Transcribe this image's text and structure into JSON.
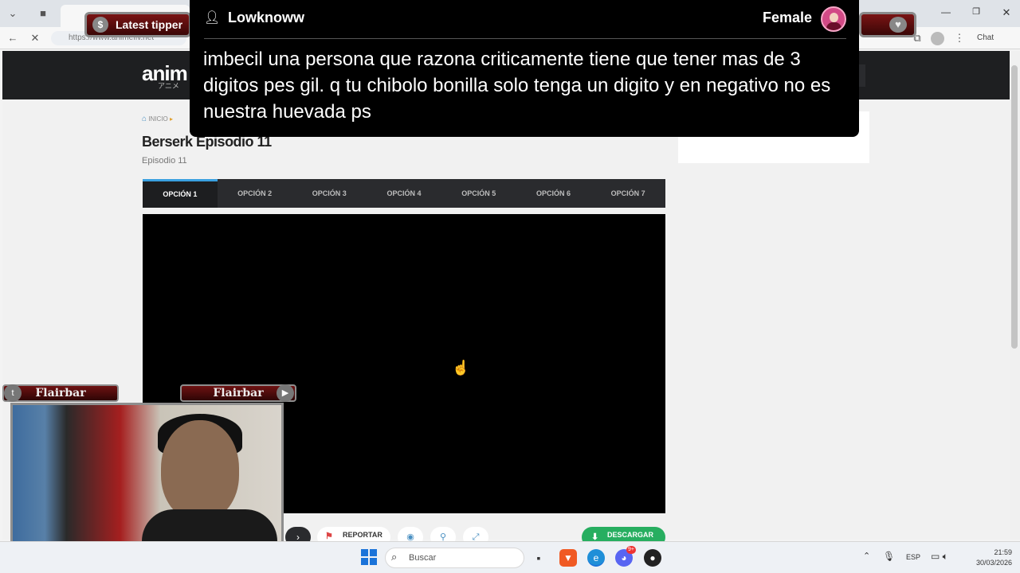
{
  "browser": {
    "url": "https://www.animeflv.net",
    "chat_label": "Chat",
    "min_icon": "minimize-icon",
    "max_icon": "maximize-icon",
    "close_icon": "close-icon"
  },
  "site": {
    "logo": "anim",
    "logo_sub": "アニメ",
    "breadcrumb_home": "INICIO",
    "title": "Berserk Episodio 11",
    "subtitle": "Episodio 11",
    "tabs": [
      "OPCIÓN 1",
      "OPCIÓN 2",
      "OPCIÓN 3",
      "OPCIÓN 4",
      "OPCIÓN 5",
      "OPCIÓN 6",
      "OPCIÓN 7"
    ],
    "active_tab": 0,
    "report_label": "REPORTAR",
    "download_label": "DESCARGAR"
  },
  "chat": {
    "username": "Lowknoww",
    "gender": "Female",
    "message": "imbecil una persona que razona criticamente tiene que tener mas de 3 digitos pes gil. q tu chibolo bonilla solo tenga un digito y en negativo no es nuestra huevada ps"
  },
  "overlay": {
    "tipper_label": "Latest tipper",
    "flairbar_label": "Flairbar"
  },
  "taskbar": {
    "search_placeholder": "Buscar",
    "lang": "ESP",
    "time": "21:59",
    "date": "30/03/2026",
    "discord_badge": "9+"
  },
  "colors": {
    "accent": "#3aa0e0",
    "download": "#27ae60",
    "header": "#1e1f21"
  }
}
